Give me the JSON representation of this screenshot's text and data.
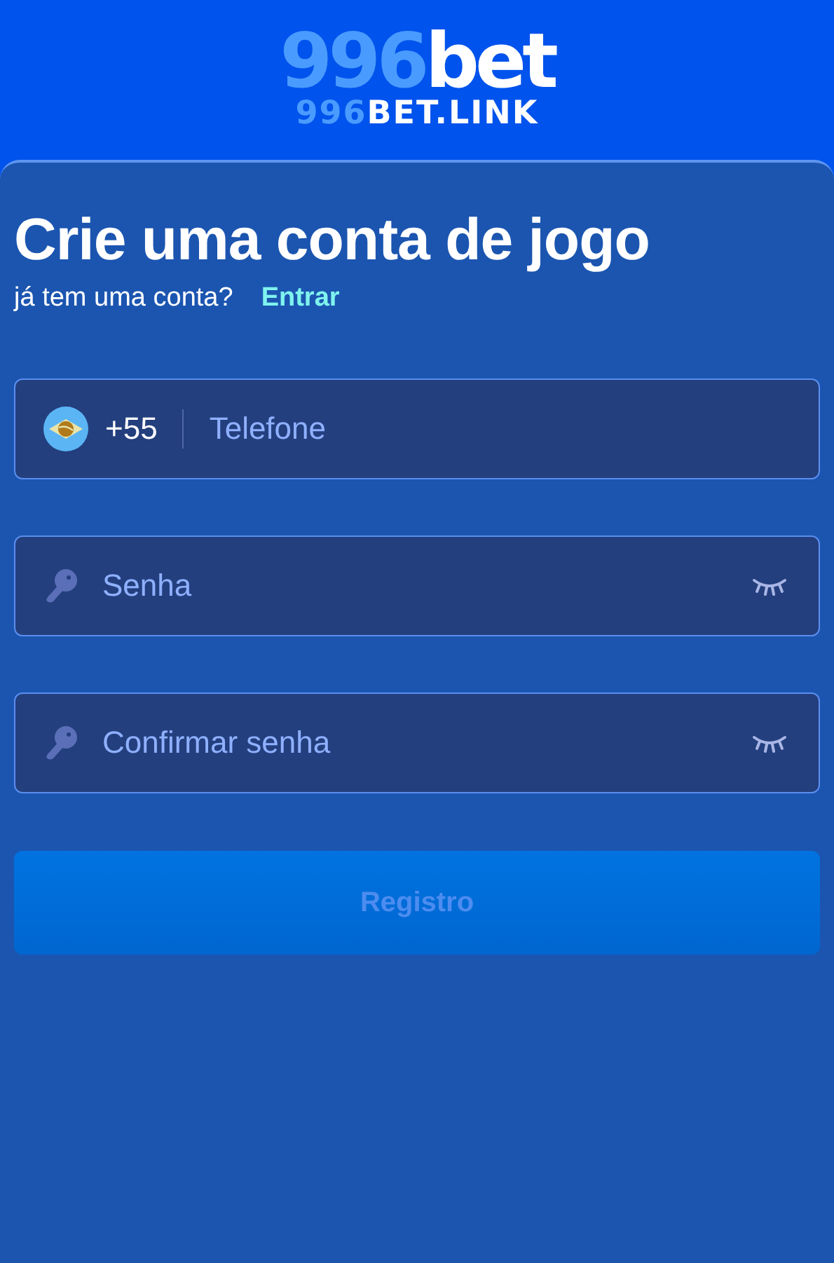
{
  "logo": {
    "number": "996",
    "word": "bet"
  },
  "domain": {
    "number": "996",
    "word": "BET.LINK"
  },
  "title": "Crie uma conta de jogo",
  "login_prompt": {
    "text": "já tem uma conta?",
    "link": "Entrar"
  },
  "fields": [
    {
      "kind": "phone",
      "country_code": "+55",
      "placeholder": "Telefone"
    },
    {
      "kind": "password",
      "placeholder": "Senha"
    },
    {
      "kind": "password",
      "placeholder": "Confirmar senha"
    }
  ],
  "submit": {
    "label": "Registro",
    "disabled": true
  }
}
